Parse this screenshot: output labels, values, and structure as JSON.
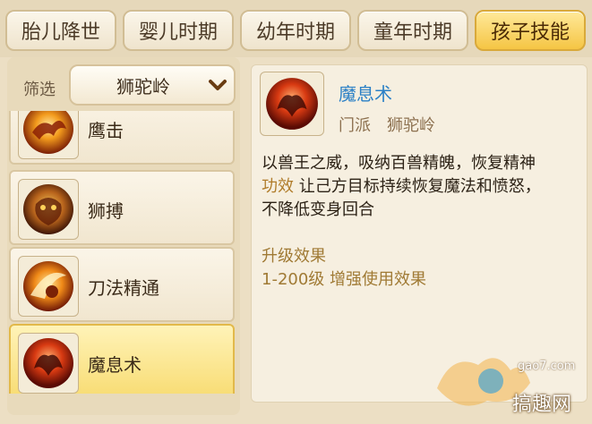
{
  "tabs": [
    {
      "label": "胎儿降世",
      "active": false
    },
    {
      "label": "婴儿时期",
      "active": false
    },
    {
      "label": "幼年时期",
      "active": false
    },
    {
      "label": "童年时期",
      "active": false
    },
    {
      "label": "孩子技能",
      "active": true
    }
  ],
  "filter": {
    "label": "筛选",
    "selected": "狮驼岭"
  },
  "skills": [
    {
      "name": "鹰击",
      "icon": "eagle-strike-icon"
    },
    {
      "name": "狮搏",
      "icon": "lion-pounce-icon"
    },
    {
      "name": "刀法精通",
      "icon": "blade-mastery-icon"
    },
    {
      "name": "魔息术",
      "icon": "demon-breath-icon",
      "selected": true
    }
  ],
  "detail": {
    "name": "魔息术",
    "school_label": "门派",
    "school_value": "狮驼岭",
    "description": "以兽王之威，吸纳百兽精魄，恢复精神",
    "effect_label": "功效",
    "effect_text": "让己方目标持续恢复魔法和愤怒，",
    "effect_text2": "不降低变身回合",
    "upgrade_title": "升级效果",
    "upgrade_text": "1-200级 增强使用效果"
  },
  "watermark": {
    "site": "gao7.com",
    "name": "搞趣网"
  },
  "colors": {
    "accent_tab": "#f5c544",
    "skill_name": "#2b80c6",
    "keyword": "#b07c2a"
  }
}
